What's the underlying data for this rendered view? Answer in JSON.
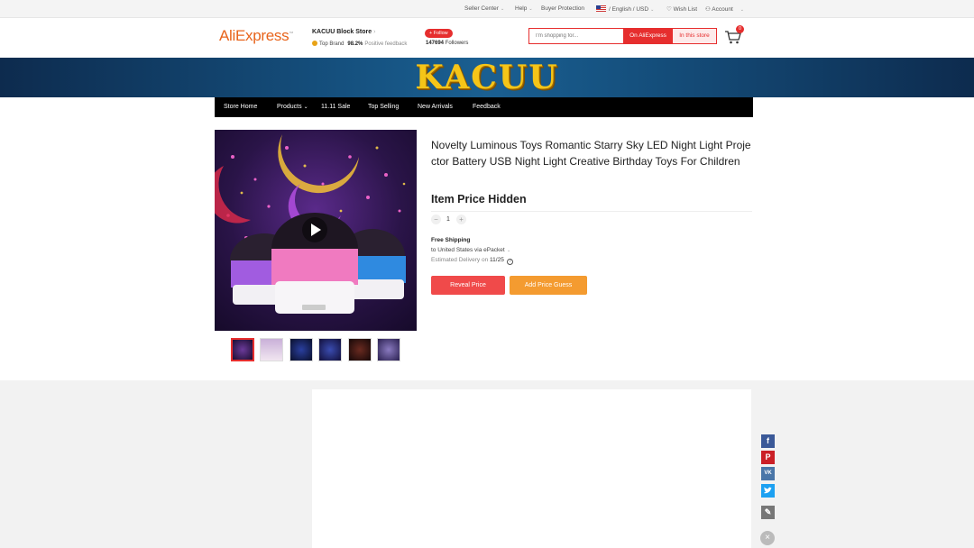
{
  "topbar": {
    "seller_center": "Seller Center",
    "help": "Help",
    "buyer_protection": "Buyer Protection",
    "language": "/ English /",
    "currency": "USD",
    "wish_list": "Wish List",
    "account": "Account"
  },
  "header": {
    "logo_ali": "Ali",
    "logo_express": "Express",
    "store_name": "KACUU Block Store",
    "top_brand": "Top Brand",
    "positive_pct": "98.2%",
    "positive_label": "Positive feedback",
    "follow_label": "+ Follow",
    "followers_count": "147694",
    "followers_label": "Followers",
    "cart_count": "0"
  },
  "search": {
    "placeholder": "I'm shopping for...",
    "on_aliexpress": "On AliExpress",
    "in_store": "In this store"
  },
  "banner": {
    "brand": "KACUU"
  },
  "nav": {
    "items": [
      "Store Home",
      "Products",
      "11.11 Sale",
      "Top Selling",
      "New Arrivals",
      "Feedback"
    ]
  },
  "product": {
    "title": "Novelty Luminous Toys Romantic Starry Sky LED Night Light Projector Battery USB Night Light Creative Birthday Toys For Children",
    "price_text": "Item Price Hidden",
    "quantity": "1",
    "shipping_title": "Free Shipping",
    "shipping_to": "to United States via ePacket",
    "estimated_label": "Estimated Delivery on",
    "estimated_date": "11/25",
    "reveal_price_label": "Reveal Price",
    "add_guess_label": "Add Price Guess"
  },
  "colors": {
    "accent_red": "#e62e2e",
    "orange": "#f49b30",
    "banner_blue": "#15507e"
  }
}
